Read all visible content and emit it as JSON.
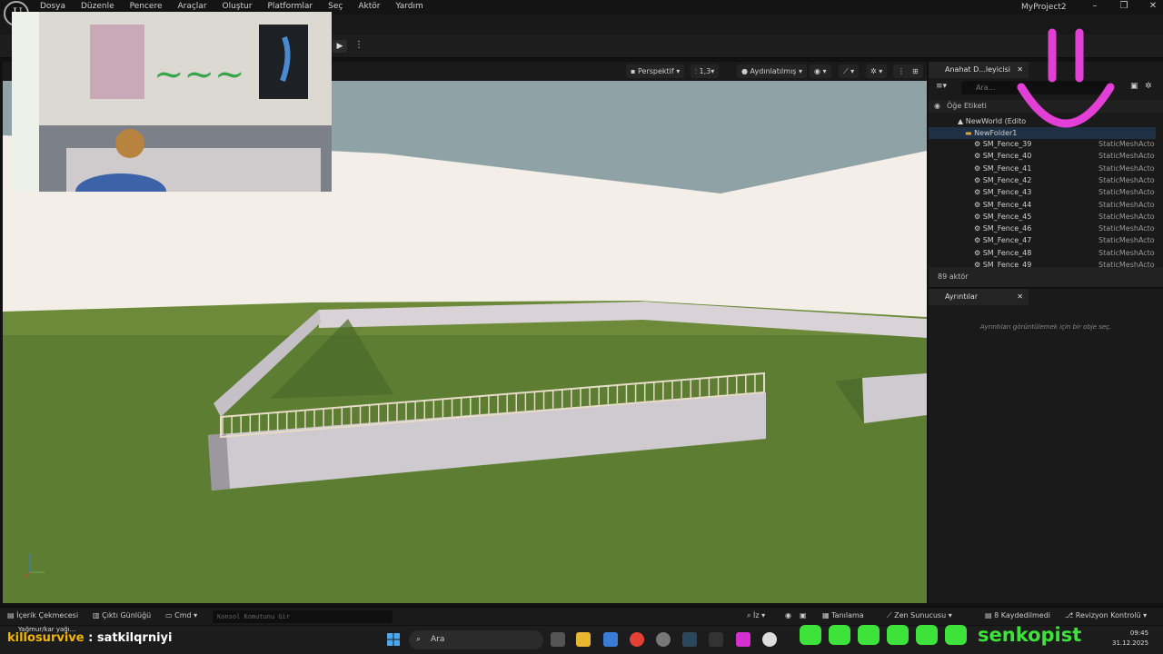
{
  "menu": {
    "logo": "U",
    "items": [
      "Dosya",
      "Düzenle",
      "Pencere",
      "Araçlar",
      "Oluştur",
      "Platformlar",
      "Seç",
      "Aktör",
      "Yardım"
    ],
    "project": "MyProject2",
    "window_controls": [
      "–",
      "❐",
      "✕"
    ]
  },
  "toolbar": {
    "play_icon": "play-icon",
    "play_glyph": "▶",
    "more_glyph": "⋮"
  },
  "viewport": {
    "perspective": "Perspektif",
    "zoom": "1,3",
    "lighting": "Aydınlatılmış",
    "colors": {
      "sky": "#8fa3a6",
      "wall": "#f3efe8",
      "ground": "#5d7d33",
      "fence_wall": "#c9c3c9",
      "picket": "#e6dcc7"
    }
  },
  "outliner": {
    "tab_label": "Anahat D...leyicisi",
    "search_placeholder": "Ara...",
    "column_label": "Öğe Etiketi",
    "world": "NewWorld (Edito",
    "folder": "NewFolder1",
    "rows": [
      {
        "name": "SM_Fence_39",
        "type": "StaticMeshActo"
      },
      {
        "name": "SM_Fence_40",
        "type": "StaticMeshActo"
      },
      {
        "name": "SM_Fence_41",
        "type": "StaticMeshActo"
      },
      {
        "name": "SM_Fence_42",
        "type": "StaticMeshActo"
      },
      {
        "name": "SM_Fence_43",
        "type": "StaticMeshActo"
      },
      {
        "name": "SM_Fence_44",
        "type": "StaticMeshActo"
      },
      {
        "name": "SM_Fence_45",
        "type": "StaticMeshActo"
      },
      {
        "name": "SM_Fence_46",
        "type": "StaticMeshActo"
      },
      {
        "name": "SM_Fence_47",
        "type": "StaticMeshActo"
      },
      {
        "name": "SM_Fence_48",
        "type": "StaticMeshActo"
      },
      {
        "name": "SM_Fence_49",
        "type": "StaticMeshActo"
      }
    ],
    "actor_count": "89 aktör"
  },
  "details": {
    "tab_label": "Ayrıntılar",
    "empty_message": "Ayrıntıları görüntülemek için bir obje seç."
  },
  "bottombar": {
    "content_drawer": "İçerik Çekmecesi",
    "output_log": "Çıktı Günlüğü",
    "cmd": "Cmd",
    "console_placeholder": "Konsol Komutunu Gir",
    "trace": "İz",
    "diagnostics": "Tanılama",
    "zen": "Zen Sunucusu",
    "saved": "8 Kaydedilmedi",
    "revision": "Revizyon Kontrolü"
  },
  "taskbar": {
    "stream_name": "killosurvive",
    "stream_text": ": satkilqrniyi",
    "news": "Yağmur/kar yağı...",
    "search_label": "Ara",
    "time": "09:45",
    "date": "31.12.2025"
  },
  "overlay": {
    "brand": "senkopist",
    "accent": "#3de33a",
    "smiley_color": "#e23fd6"
  }
}
